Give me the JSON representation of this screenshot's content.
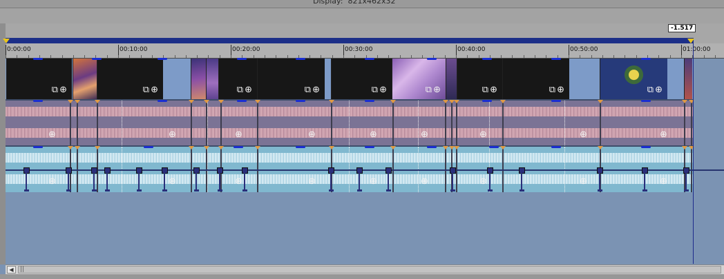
{
  "header": {
    "display_label": "Display:",
    "display_value": "821x462x32"
  },
  "cursor_position": "-1.517",
  "ruler": {
    "labels": [
      "0:00:00",
      "00:10:00",
      "00:20:00",
      "00:30:00",
      "00:40:00",
      "00:50:00",
      "01:00:00"
    ]
  },
  "colors": {
    "marker_bar": "#1c2f88",
    "video_track": "#7d9bc8",
    "audio_track_1": "#7b7395",
    "audio_track_2": "#80b8cf",
    "envelope": "#2a2f7a",
    "fade_marker": "#e19a43",
    "loop_marker": "#e9c51d"
  },
  "icons": {
    "clip_crop": "crop-icon",
    "clip_event_fx": "event-fx-icon",
    "scroll_left": "scroll-left-arrow-icon"
  },
  "scrollbar": {
    "left_arrow": "◀",
    "grip": "||"
  }
}
